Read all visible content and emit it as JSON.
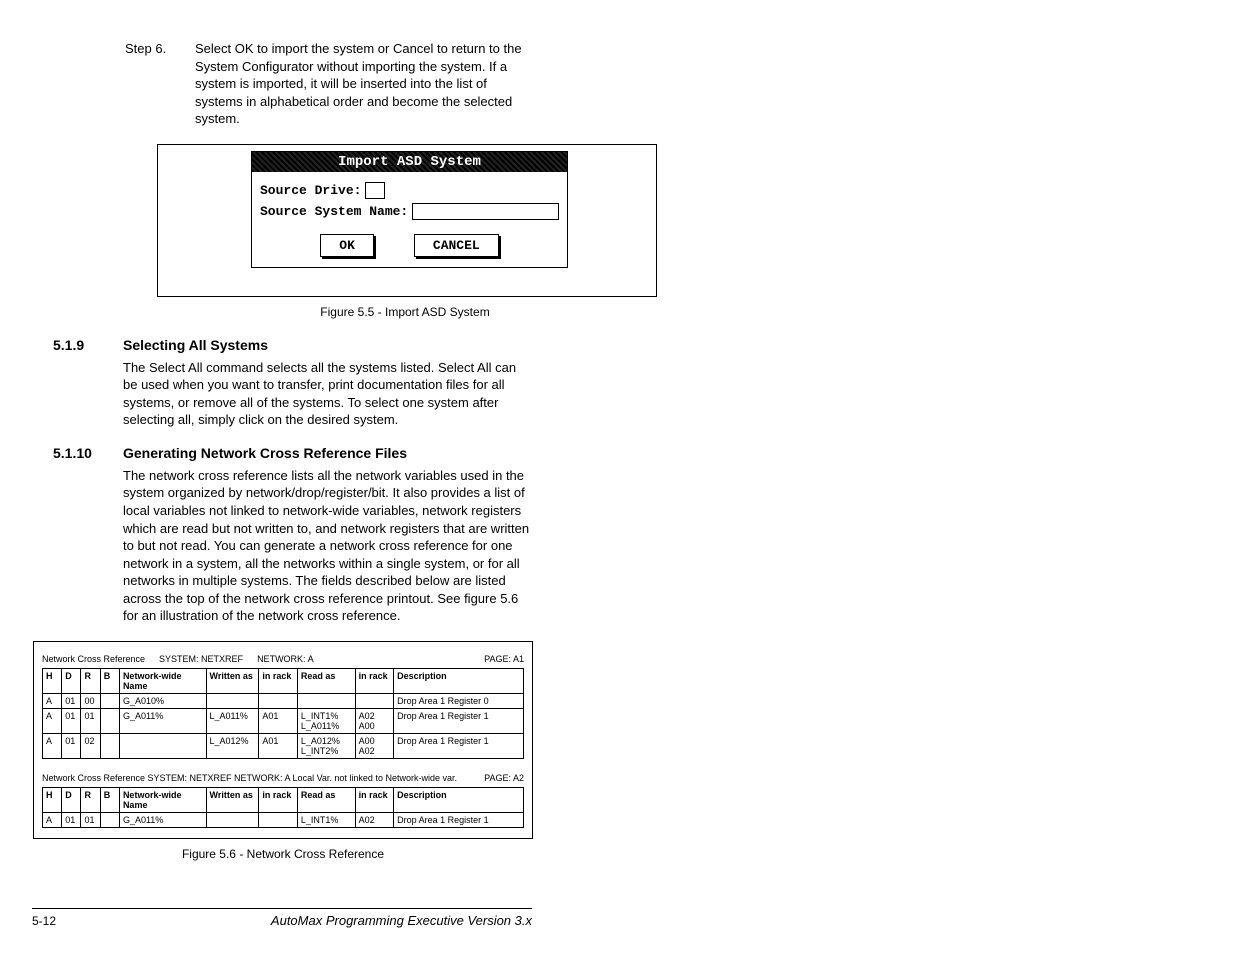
{
  "step6": {
    "label": "Step 6.",
    "text": "Select OK to import the system or Cancel to return to the System Configurator without importing the system. If a system is imported, it will be inserted into the list of systems in alphabetical order and become the selected system."
  },
  "dialog": {
    "title": "Import ASD System",
    "source_drive_label": "Source Drive:",
    "source_system_label": "Source System Name:",
    "ok": "OK",
    "cancel": "CANCEL"
  },
  "fig55": "Figure 5.5 - Import ASD System",
  "sec519": {
    "num": "5.1.9",
    "title": "Selecting All Systems",
    "body": "The Select All command selects all the systems listed. Select All can be used when you want to transfer, print documentation files for all systems, or remove all of the systems. To select one system after selecting all, simply click on the desired system."
  },
  "sec5110": {
    "num": "5.1.10",
    "title": "Generating Network Cross Reference Files",
    "body": "The network cross reference lists all the network variables used in the system organized by network/drop/register/bit. It also provides a list of local variables not linked to network-wide variables, network registers which are read but not written to, and network registers that are written to but not read. You can generate a network cross reference for one network in a system, all the networks within a single system, or for all networks in multiple systems. The fields described below are listed across the top of the network cross reference printout. See figure 5.6 for an illustration of the network cross reference."
  },
  "xref": {
    "hdr_label": "Network Cross Reference",
    "hdr_system": "SYSTEM: NETXREF",
    "hdr_network": "NETWORK: A",
    "hdr_page": "PAGE: A1",
    "cols": {
      "H": "H",
      "D": "D",
      "R": "R",
      "B": "B",
      "nwn": "Network-wide Name",
      "wa": "Written as",
      "ir": "in rack",
      "ra": "Read as",
      "ir2": "in rack",
      "desc": "Description"
    },
    "rows": [
      {
        "H": "A",
        "D": "01",
        "R": "00",
        "B": "",
        "nwn": "G_A010%",
        "wa": "",
        "ir": "",
        "ra": "",
        "ir2": "",
        "desc": "Drop Area 1 Register 0"
      },
      {
        "H": "A",
        "D": "01",
        "R": "01",
        "B": "",
        "nwn": "G_A011%",
        "wa": "L_A011%",
        "ir": "A01",
        "ra": "L_INT1%\nL_A011%",
        "ir2": "A02\nA00",
        "desc": "Drop Area 1 Register 1"
      },
      {
        "H": "A",
        "D": "01",
        "R": "02",
        "B": "",
        "nwn": "",
        "wa": "L_A012%",
        "ir": "A01",
        "ra": "L_A012%\nL_INT2%",
        "ir2": "A00\nA02",
        "desc": "Drop Area 1 Register 1"
      }
    ],
    "sub_hdr": "Network Cross Reference SYSTEM: NETXREF NETWORK: A  Local Var. not linked to Network-wide var.",
    "sub_page": "PAGE: A2",
    "sub_rows": [
      {
        "H": "A",
        "D": "01",
        "R": "01",
        "B": "",
        "nwn": "G_A011%",
        "wa": "",
        "ir": "",
        "ra": "L_INT1%",
        "ir2": "A02",
        "desc": "Drop Area 1 Register 1"
      }
    ]
  },
  "fig56": "Figure 5.6 - Network Cross Reference",
  "footer": {
    "page": "5-12",
    "title": "AutoMax Programming Executive Version 3.x"
  }
}
